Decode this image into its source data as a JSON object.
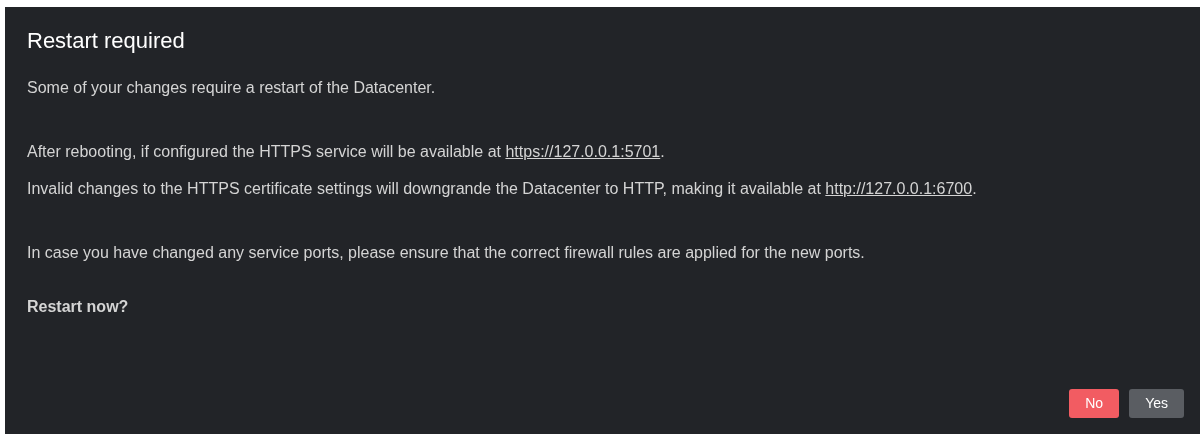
{
  "dialog": {
    "title": "Restart required",
    "blocks": [
      [
        {
          "kind": "text",
          "text": "Some of your changes require a restart of the Datacenter."
        }
      ],
      [
        {
          "kind": "link",
          "before": "After rebooting, if configured the HTTPS service will be available at ",
          "link": "https://127.0.0.1:5701",
          "after": "."
        },
        {
          "kind": "link",
          "before": "Invalid changes to the HTTPS certificate settings will downgrande the Datacenter to HTTP, making it available at ",
          "link": "http://127.0.0.1:6700",
          "after": "."
        }
      ],
      [
        {
          "kind": "text",
          "text": "In case you have changed any service ports, please ensure that the correct firewall rules are applied for the new ports."
        }
      ],
      [
        {
          "kind": "bold",
          "text": "Restart now?"
        }
      ]
    ],
    "buttons": [
      {
        "label": "No",
        "kind": "danger"
      },
      {
        "label": "Yes",
        "kind": "secondary"
      }
    ]
  }
}
